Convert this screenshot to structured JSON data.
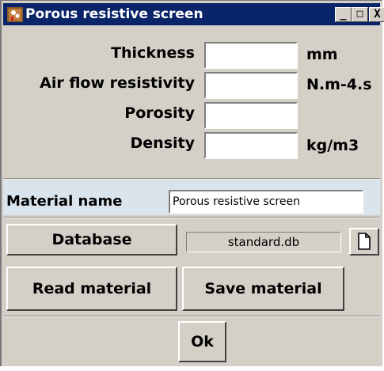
{
  "window": {
    "title": "Porous resistive screen",
    "controls": [
      "_",
      "□",
      "X"
    ]
  },
  "params": [
    {
      "label": "Thickness",
      "value": "",
      "unit": "mm"
    },
    {
      "label": "Air flow resistivity",
      "value": "",
      "unit": "N.m-4.s"
    },
    {
      "label": "Porosity",
      "value": "",
      "unit": ""
    },
    {
      "label": "Density",
      "value": "",
      "unit": "kg/m3"
    }
  ],
  "material": {
    "label": "Material name",
    "value": "Porous resistive screen"
  },
  "database": {
    "button": "Database",
    "file": "standard.db"
  },
  "actions": {
    "read": "Read material",
    "save": "Save material",
    "ok": "Ok"
  },
  "colors": {
    "titlebar": "#0a246a",
    "face": "#d4d0c8",
    "highlight_bg": "#d9e4ec"
  }
}
